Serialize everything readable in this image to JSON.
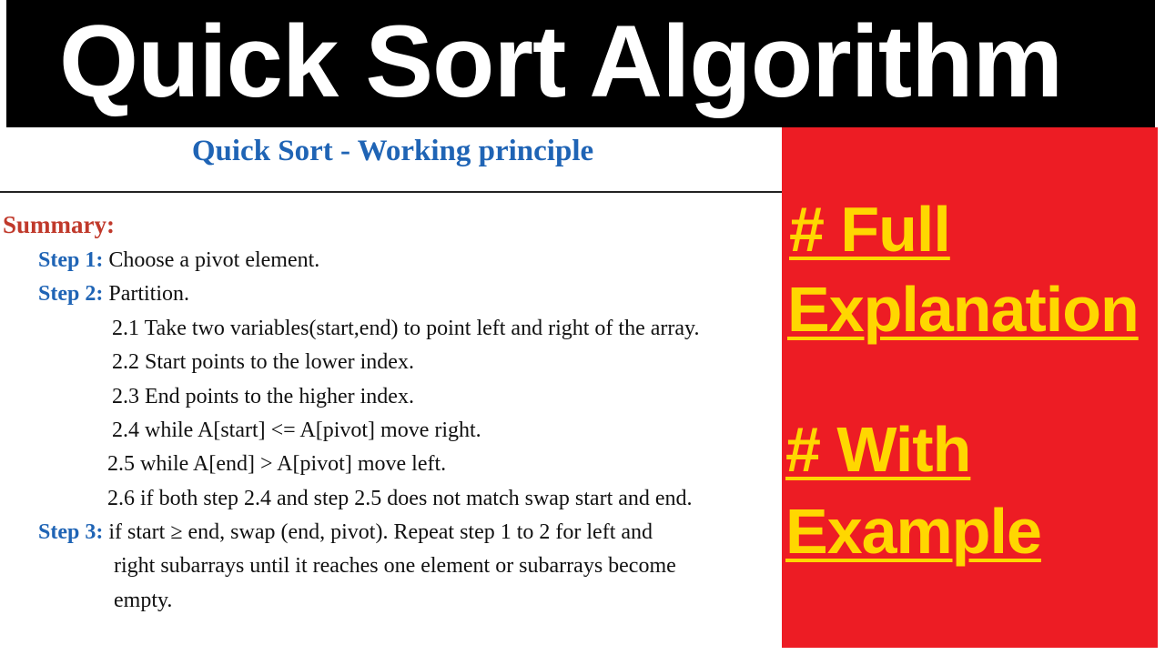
{
  "title_banner": {
    "text": "Quick Sort Algorithm",
    "background": "#000000",
    "color": "#ffffff"
  },
  "slide": {
    "heading": "Quick Sort - Working principle",
    "summary_label": "Summary:",
    "steps": [
      {
        "label": "Step 1:",
        "text": "Choose a pivot element."
      },
      {
        "label": "Step 2:",
        "text": "Partition."
      }
    ],
    "substeps": [
      "2.1 Take two variables(start,end) to point left and right of the array.",
      "2.2 Start points to the lower index.",
      "2.3 End points to the higher index.",
      "2.4 while A[start] <= A[pivot] move right.",
      "2.5 while A[end] > A[pivot] move left.",
      "2.6 if both step 2.4 and step 2.5 does not match swap start and end."
    ],
    "step3": {
      "label": "Step 3:",
      "lines": [
        "if start ≥ end, swap (end, pivot). Repeat step 1 to 2 for left and",
        "right subarrays until it reaches one element or subarrays become",
        "empty."
      ]
    },
    "colors": {
      "heading": "#1f64b5",
      "summary": "#c0392b",
      "step_label": "#1f64b5",
      "body": "#111111"
    }
  },
  "promo_panel": {
    "background": "#ed1c24",
    "text_color": "#ffd700",
    "lines": [
      "# Full",
      "Explanation",
      "# With",
      "Example"
    ]
  }
}
